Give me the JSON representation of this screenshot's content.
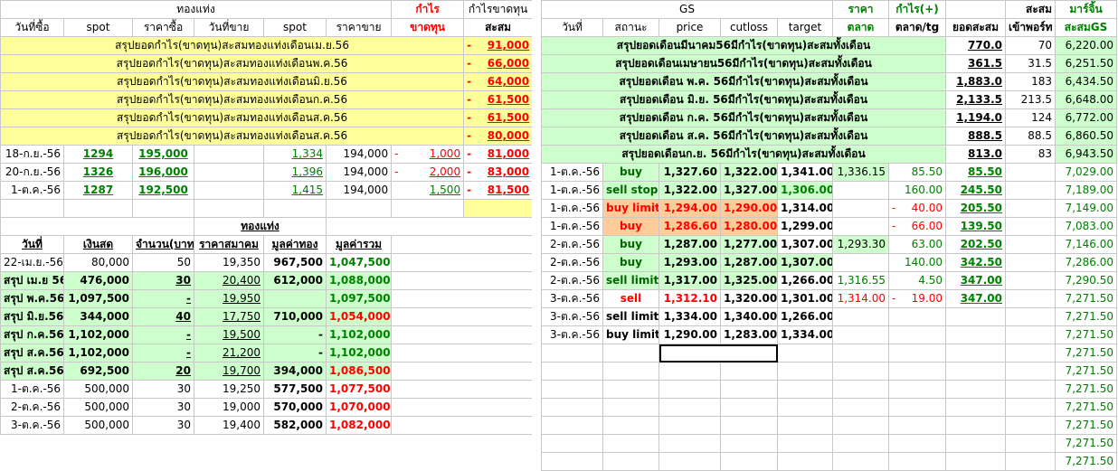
{
  "left": {
    "group_headers": {
      "gold": "ทองแท่ง",
      "profit": "กำไร",
      "profit_loss": "กำไรขาดทุน"
    },
    "headers": [
      "วันที่ซื้อ",
      "spot",
      "ราคาซื้อ",
      "วันที่ขาย",
      "spot",
      "ราคาขาย",
      "ขาดทุน",
      "สะสม"
    ],
    "summaries": [
      {
        "text": "สรุปยอดกำไร(ขาดทุน)สะสมทองแท่งเดือนเม.ย.56",
        "sign": "-",
        "value": "91,000"
      },
      {
        "text": "สรุปยอดกำไร(ขาดทุน)สะสมทองแท่งเดือนพ.ค.56",
        "sign": "-",
        "value": "66,000"
      },
      {
        "text": "สรุปยอดกำไร(ขาดทุน)สะสมทองแท่งเดือนมิ.ย.56",
        "sign": "-",
        "value": "64,000"
      },
      {
        "text": "สรุปยอดกำไร(ขาดทุน)สะสมทองแท่งเดือนก.ค.56",
        "sign": "-",
        "value": "61,500"
      },
      {
        "text": "สรุปยอดกำไร(ขาดทุน)สะสมทองแท่งเดือนส.ค.56",
        "sign": "-",
        "value": "61,500"
      },
      {
        "text": "สรุปยอดกำไร(ขาดทุน)สะสมทองแท่งเดือนส.ค.56",
        "sign": "-",
        "value": "80,000"
      }
    ],
    "trades": [
      {
        "buy_date": "18-ก.ย.-56",
        "spot": "1294",
        "buy_price": "195,000",
        "sell_date": "",
        "sell_spot": "1,334",
        "sell_price": "194,000",
        "sign": "-",
        "pl": "1,000",
        "cum_sign": "-",
        "cum": "81,000"
      },
      {
        "buy_date": "20-ก.ย.-56",
        "spot": "1326",
        "buy_price": "196,000",
        "sell_date": "",
        "sell_spot": "1,396",
        "sell_price": "194,000",
        "sign": "-",
        "pl": "2,000",
        "cum_sign": "-",
        "cum": "83,000"
      },
      {
        "buy_date": "1-ต.ค.-56",
        "spot": "1287",
        "buy_price": "192,500",
        "sell_date": "",
        "sell_spot": "1,415",
        "sell_price": "194,000",
        "sign": "",
        "pl": "1,500",
        "cum_sign": "-",
        "cum": "81,500"
      }
    ],
    "holdings_title": "ทองแท่ง",
    "holdings_headers": [
      "วันที่",
      "เงินสด",
      "จำนวน(บาท)",
      "ราคาสมาคม",
      "มูลค่าทอง",
      "มูลค่ารวม"
    ],
    "holdings": [
      {
        "date": "22-เม.ย.-56",
        "cash": "80,000",
        "qty": "50",
        "price": "19,350",
        "gold": "967,500",
        "total": "1,047,500",
        "style": "plain"
      },
      {
        "date": "สรุป เม.ย 56",
        "cash": "476,000",
        "qty": "30",
        "price": "20,400",
        "gold": "612,000",
        "total": "1,088,000",
        "style": "sum"
      },
      {
        "date": "สรุป พ.ค.56",
        "cash": "1,097,500",
        "qty": "-",
        "price": "19,950",
        "gold": "",
        "total": "1,097,500",
        "style": "sum"
      },
      {
        "date": "สรุป มิ.ย.56",
        "cash": "344,000",
        "qty": "40",
        "price": "17,750",
        "gold": "710,000",
        "total": "1,054,000",
        "style": "sumred"
      },
      {
        "date": "สรุป ก.ค.56",
        "cash": "1,102,000",
        "qty": "-",
        "price": "19,500",
        "gold": "-",
        "total": "1,102,000",
        "style": "sum"
      },
      {
        "date": "สรุป ส.ค.56",
        "cash": "1,102,000",
        "qty": "-",
        "price": "21,200",
        "gold": "-",
        "total": "1,102,000",
        "style": "sum"
      },
      {
        "date": "สรุป ส.ค.56",
        "cash": "692,500",
        "qty": "20",
        "price": "19,700",
        "gold": "394,000",
        "total": "1,086,500",
        "style": "sumred"
      },
      {
        "date": "1-ต.ค.-56",
        "cash": "500,000",
        "qty": "30",
        "price": "19,250",
        "gold": "577,500",
        "total": "1,077,500",
        "style": "plainred"
      },
      {
        "date": "2-ต.ค.-56",
        "cash": "500,000",
        "qty": "30",
        "price": "19,000",
        "gold": "570,000",
        "total": "1,070,000",
        "style": "plainred"
      },
      {
        "date": "3-ต.ค.-56",
        "cash": "500,000",
        "qty": "30",
        "price": "19,400",
        "gold": "582,000",
        "total": "1,082,000",
        "style": "plainred"
      }
    ]
  },
  "right": {
    "group_headers": {
      "gs": "GS",
      "price": "ราคา",
      "profit": "กำไร(+)",
      "cum": "สะสม",
      "margin": "มาร์จิ้น"
    },
    "headers": [
      "วันที่",
      "สถานะ",
      "price",
      "cutloss",
      "target",
      "ตลาด",
      "ตลาด/tg",
      "ยอดสะสม",
      "เข้าพอร์ท",
      "สะสมGS"
    ],
    "summaries": [
      {
        "text": "สรุปยอดเดือนมีนาคม56มีกำไร(ขาดทุน)สะสมทั้งเดือน",
        "cum": "770.0",
        "port": "70",
        "gs": "6,220.00"
      },
      {
        "text": "สรุปยอดเดือนเมษายน56มีกำไร(ขาดทุน)สะสมทั้งเดือน",
        "cum": "361.5",
        "port": "31.5",
        "gs": "6,251.50"
      },
      {
        "text": "สรุปยอดเดือน พ.ค. 56มีกำไร(ขาดทุน)สะสมทั้งเดือน",
        "cum": "1,883.0",
        "port": "183",
        "gs": "6,434.50"
      },
      {
        "text": "สรุปยอดเดือน มิ.ย. 56มีกำไร(ขาดทุน)สะสมทั้งเดือน",
        "cum": "2,133.5",
        "port": "213.5",
        "gs": "6,648.00"
      },
      {
        "text": "สรุปยอดเดือน ก.ค. 56มีกำไร(ขาดทุน)สะสมทั้งเดือน",
        "cum": "1,194.0",
        "port": "124",
        "gs": "6,772.00"
      },
      {
        "text": "สรุปยอดเดือน ส.ค. 56มีกำไร(ขาดทุน)สะสมทั้งเดือน",
        "cum": "888.5",
        "port": "88.5",
        "gs": "6,860.50"
      },
      {
        "text": "สรุปยอดเดือนก.ย. 56มีกำไร(ขาดทุน)สะสมทั้งเดือน",
        "cum": "813.0",
        "port": "83",
        "gs": "6,943.50"
      }
    ],
    "trades": [
      {
        "date": "1-ต.ค.-56",
        "status": "buy",
        "price": "1,327.60",
        "cutloss": "1,322.00",
        "target": "1,341.00",
        "market": "1,336.15",
        "sign": "",
        "tg": "85.50",
        "cum": "85.50",
        "gs": "7,029.00",
        "kind": "buy"
      },
      {
        "date": "1-ต.ค.-56",
        "status": "sell stop",
        "price": "1,322.00",
        "cutloss": "1,327.00",
        "target": "1,306.00",
        "market": "",
        "sign": "",
        "tg": "160.00",
        "cum": "245.50",
        "gs": "7,189.00",
        "kind": "sellstop"
      },
      {
        "date": "1-ต.ค.-56",
        "status": "buy limit",
        "price": "1,294.00",
        "cutloss": "1,290.00",
        "target": "1,314.00",
        "market": "",
        "sign": "-",
        "tg": "40.00",
        "cum": "205.50",
        "gs": "7,149.00",
        "kind": "loss"
      },
      {
        "date": "1-ต.ค.-56",
        "status": "buy",
        "price": "1,286.60",
        "cutloss": "1,280.00",
        "target": "1,299.00",
        "market": "",
        "sign": "-",
        "tg": "66.00",
        "cum": "139.50",
        "gs": "7,083.00",
        "kind": "loss"
      },
      {
        "date": "2-ต.ค.-56",
        "status": "buy",
        "price": "1,287.00",
        "cutloss": "1,277.00",
        "target": "1,307.00",
        "market": "1,293.30",
        "sign": "",
        "tg": "63.00",
        "cum": "202.50",
        "gs": "7,146.00",
        "kind": "buy"
      },
      {
        "date": "2-ต.ค.-56",
        "status": "buy",
        "price": "1,293.00",
        "cutloss": "1,287.00",
        "target": "1,307.00",
        "market": "",
        "sign": "",
        "tg": "140.00",
        "cum": "342.50",
        "gs": "7,286.00",
        "kind": "buy2"
      },
      {
        "date": "2-ต.ค.-56",
        "status": "sell limit",
        "price": "1,317.00",
        "cutloss": "1,325.00",
        "target": "1,266.00",
        "market": "1,316.55",
        "sign": "",
        "tg": "4.50",
        "cum": "347.00",
        "gs": "7,290.50",
        "kind": "selllimit"
      },
      {
        "date": "3-ต.ค.-56",
        "status": "sell",
        "price": "1,312.10",
        "cutloss": "1,320.00",
        "target": "1,301.00",
        "market": "1,314.00",
        "sign": "-",
        "tg": "19.00",
        "cum": "347.00",
        "gs": "7,271.50",
        "kind": "sellred"
      },
      {
        "date": "3-ต.ค.-56",
        "status": "sell limit",
        "price": "1,334.00",
        "cutloss": "1,340.00",
        "target": "1,266.00",
        "market": "",
        "sign": "",
        "tg": "",
        "cum": "",
        "gs": "7,271.50",
        "kind": "plain"
      },
      {
        "date": "3-ต.ค.-56",
        "status": "buy limit",
        "price": "1,290.00",
        "cutloss": "1,283.00",
        "target": "1,334.00",
        "market": "",
        "sign": "",
        "tg": "",
        "cum": "",
        "gs": "7,271.50",
        "kind": "plain"
      }
    ],
    "tail_gs": [
      "7,271.50",
      "7,271.50",
      "7,271.50",
      "7,271.50",
      "7,271.50",
      "7,271.50",
      "7,271.50"
    ]
  },
  "colors": {
    "yellow": "#ffff99",
    "green": "#ccffcc",
    "orange": "#ffcc99",
    "red": "#ff0000",
    "dark_green": "#008000"
  }
}
